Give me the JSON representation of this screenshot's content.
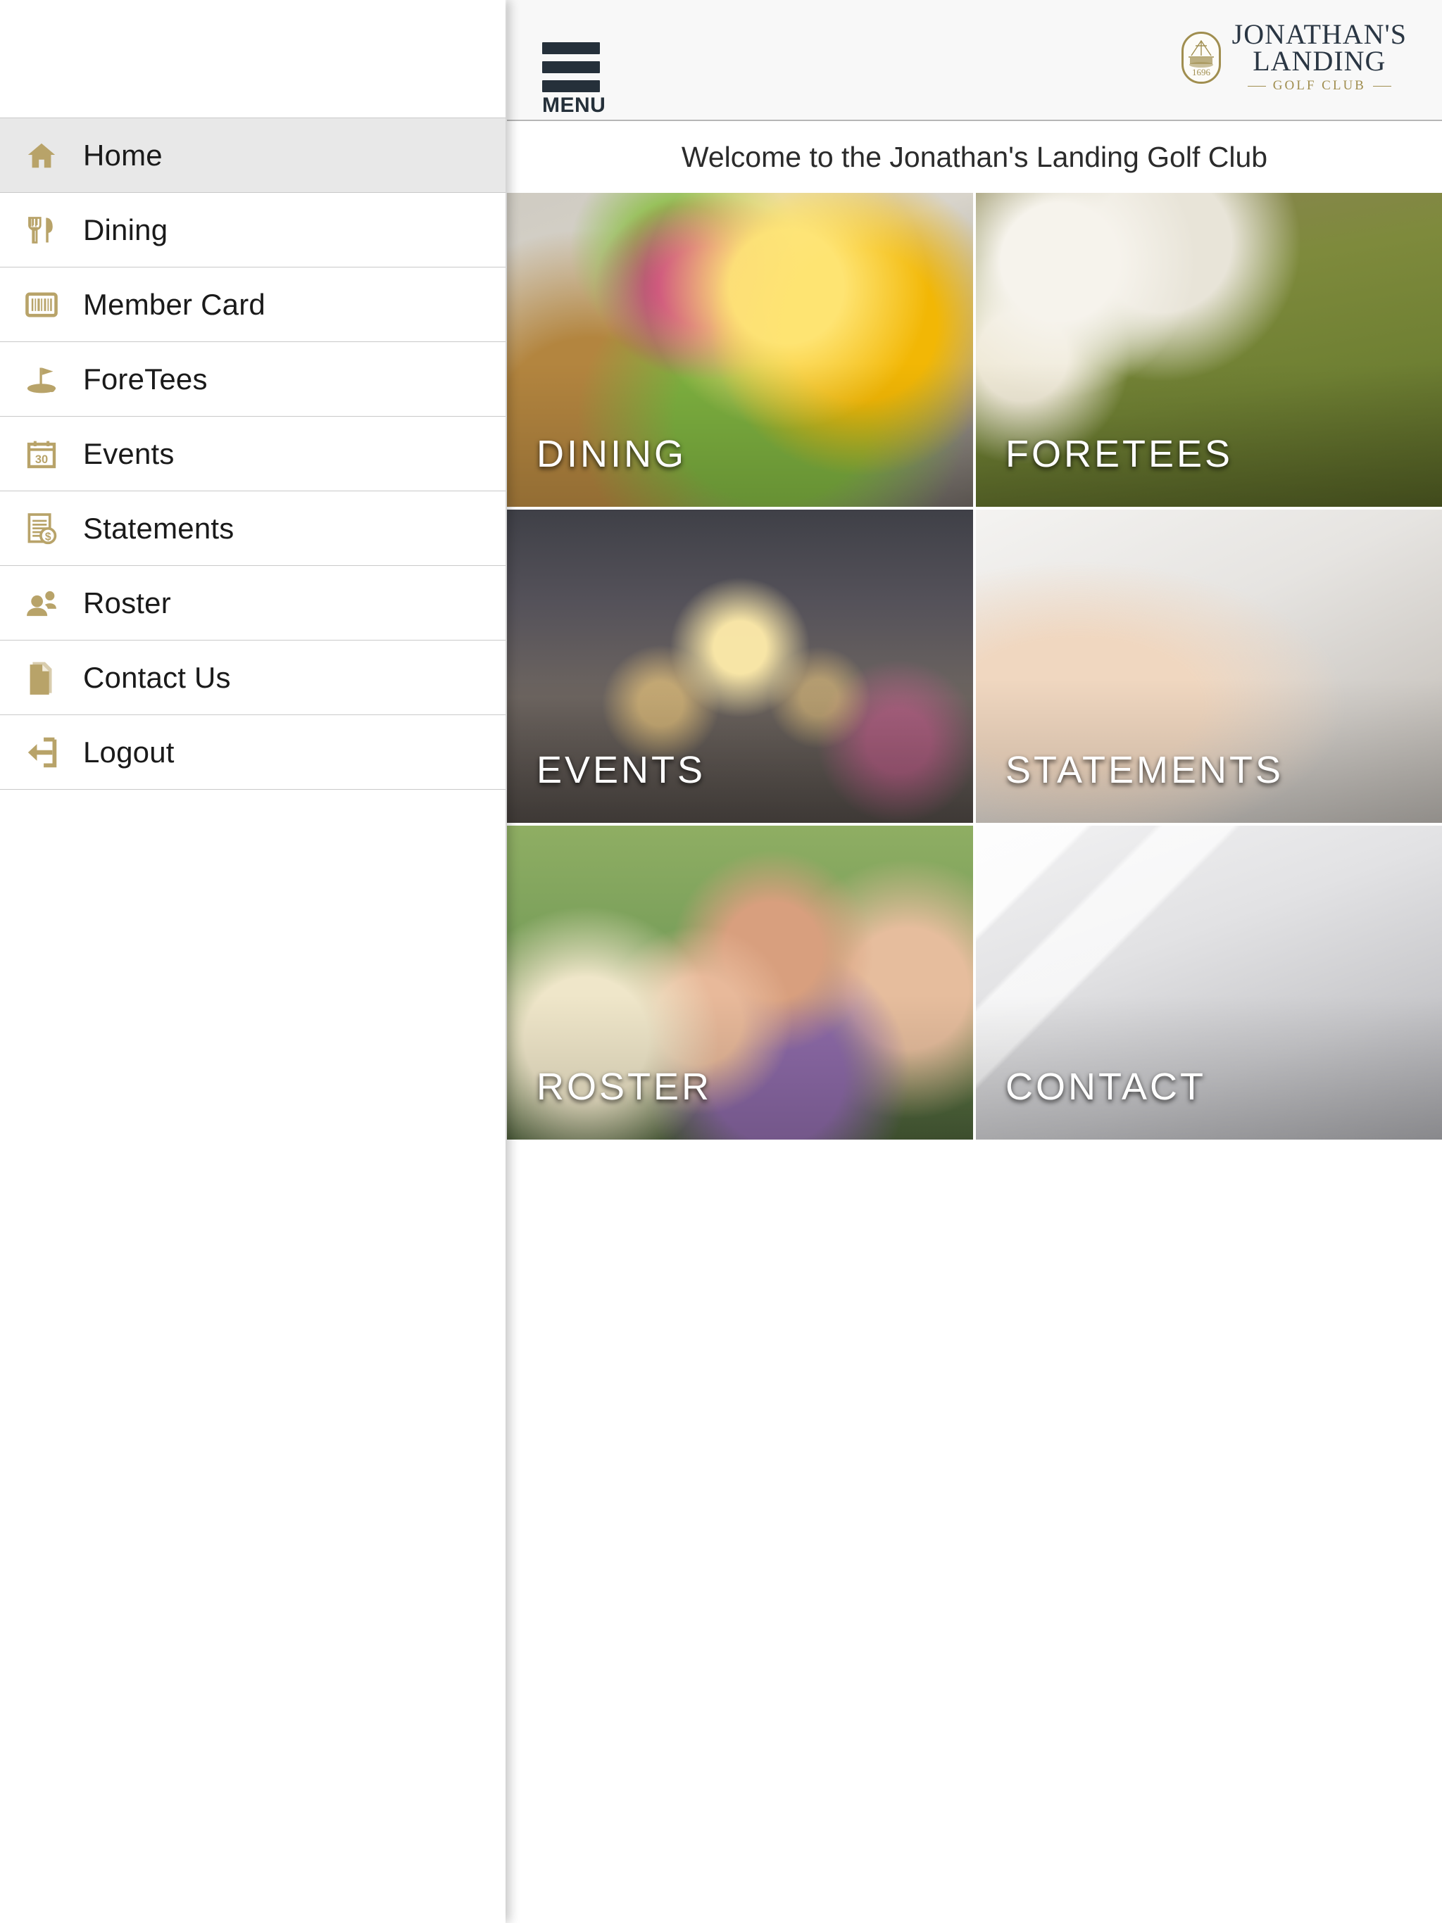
{
  "brand": {
    "crest_year": "1696",
    "line1": "JONATHAN'S",
    "line2": "LANDING",
    "sub": "GOLF CLUB",
    "gold": "#a08e4f",
    "navy": "#2b3744"
  },
  "topbar": {
    "menu_label": "MENU",
    "menu_icon": "hamburger-icon"
  },
  "welcome": {
    "text": "Welcome to the Jonathan's Landing Golf Club"
  },
  "sidebar": {
    "items": [
      {
        "label": "Home",
        "icon": "home-icon",
        "active": true
      },
      {
        "label": "Dining",
        "icon": "cutlery-icon",
        "active": false
      },
      {
        "label": "Member Card",
        "icon": "barcode-icon",
        "active": false
      },
      {
        "label": "ForeTees",
        "icon": "golf-flag-icon",
        "active": false
      },
      {
        "label": "Events",
        "icon": "calendar-icon",
        "active": false
      },
      {
        "label": "Statements",
        "icon": "invoice-icon",
        "active": false
      },
      {
        "label": "Roster",
        "icon": "people-icon",
        "active": false
      },
      {
        "label": "Contact Us",
        "icon": "document-icon",
        "active": false
      },
      {
        "label": "Logout",
        "icon": "logout-icon",
        "active": false
      }
    ],
    "icon_color": "#b8a369",
    "active_background": "#e8e8e8"
  },
  "tiles": [
    {
      "label": "DINING",
      "photo": "hamburger-sandwich-photo"
    },
    {
      "label": "FORETEES",
      "photo": "golf-ball-tee-photo"
    },
    {
      "label": "EVENTS",
      "photo": "banquet-table-candles-photo"
    },
    {
      "label": "STATEMENTS",
      "photo": "hand-signing-paper-photo"
    },
    {
      "label": "ROSTER",
      "photo": "smiling-golfers-photo"
    },
    {
      "label": "CONTACT",
      "photo": "abstract-grey-photo"
    }
  ]
}
